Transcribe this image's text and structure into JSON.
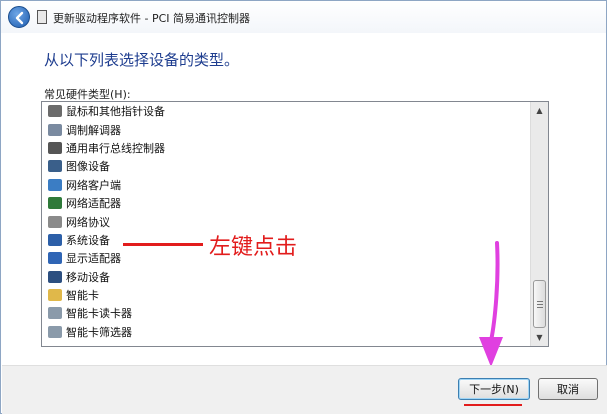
{
  "window": {
    "title": "更新驱动程序软件 - PCI 简易通讯控制器"
  },
  "main": {
    "heading": "从以下列表选择设备的类型。",
    "list_label": "常见硬件类型(H):",
    "items": [
      {
        "label": "鼠标和其他指针设备",
        "icon": "mouse-icon",
        "color": "#6b6b6b"
      },
      {
        "label": "调制解调器",
        "icon": "modem-icon",
        "color": "#7a8aa0"
      },
      {
        "label": "通用串行总线控制器",
        "icon": "usb-icon",
        "color": "#555555"
      },
      {
        "label": "图像设备",
        "icon": "camera-icon",
        "color": "#3a5f8a"
      },
      {
        "label": "网络客户端",
        "icon": "network-client-icon",
        "color": "#3b7dc4"
      },
      {
        "label": "网络适配器",
        "icon": "network-adapter-icon",
        "color": "#2f7a3a"
      },
      {
        "label": "网络协议",
        "icon": "network-protocol-icon",
        "color": "#8a8a8a"
      },
      {
        "label": "系统设备",
        "icon": "system-device-icon",
        "color": "#2c5fa8"
      },
      {
        "label": "显示适配器",
        "icon": "display-adapter-icon",
        "color": "#2f65b5"
      },
      {
        "label": "移动设备",
        "icon": "mobile-device-icon",
        "color": "#2c4f80"
      },
      {
        "label": "智能卡",
        "icon": "smart-card-icon",
        "color": "#e0b84a"
      },
      {
        "label": "智能卡读卡器",
        "icon": "smart-card-reader-icon",
        "color": "#8a9aaa"
      },
      {
        "label": "智能卡筛选器",
        "icon": "smart-card-filter-icon",
        "color": "#8a9aaa"
      }
    ]
  },
  "annotation": {
    "text": "左键点击",
    "color": "#e21c1c",
    "arrow_color": "#e040e0"
  },
  "footer": {
    "next_label": "下一步(N)",
    "cancel_label": "取消"
  }
}
